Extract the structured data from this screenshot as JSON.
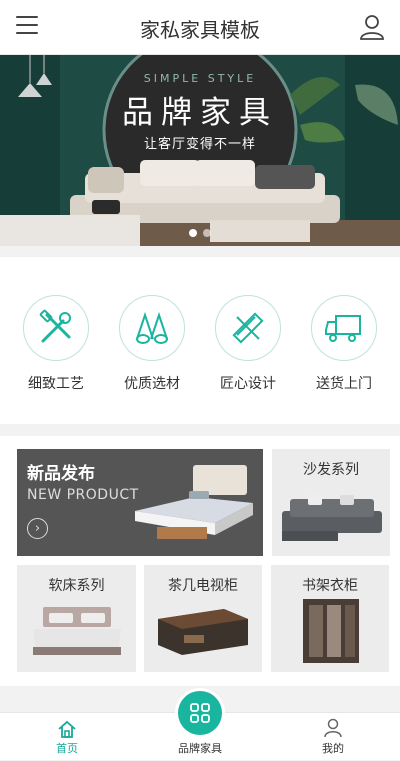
{
  "header": {
    "title": "家私家具模板"
  },
  "banner": {
    "en": "SIMPLE STYLE",
    "title": "品牌家具",
    "subtitle": "让客厅变得不一样",
    "active_slide": 1,
    "slide_count": 2
  },
  "features": [
    {
      "label": "细致工艺",
      "icon": "tools-icon"
    },
    {
      "label": "优质选材",
      "icon": "wood-roll-icon"
    },
    {
      "label": "匠心设计",
      "icon": "ruler-pencil-icon"
    },
    {
      "label": "送货上门",
      "icon": "truck-icon"
    }
  ],
  "products": {
    "new": {
      "title": "新品发布",
      "subtitle": "NEW PRODUCT",
      "arrow": "›"
    },
    "sofa": "沙发系列",
    "bed": "软床系列",
    "tv": "茶几电视柜",
    "shelf": "书架衣柜"
  },
  "tabbar": [
    {
      "label": "首页",
      "icon": "home-icon"
    },
    {
      "label": "品牌家具",
      "icon": "grid-icon"
    },
    {
      "label": "我的",
      "icon": "user-icon"
    }
  ],
  "colors": {
    "accent": "#1ab59f",
    "banner_bg": "#1f4b45"
  }
}
